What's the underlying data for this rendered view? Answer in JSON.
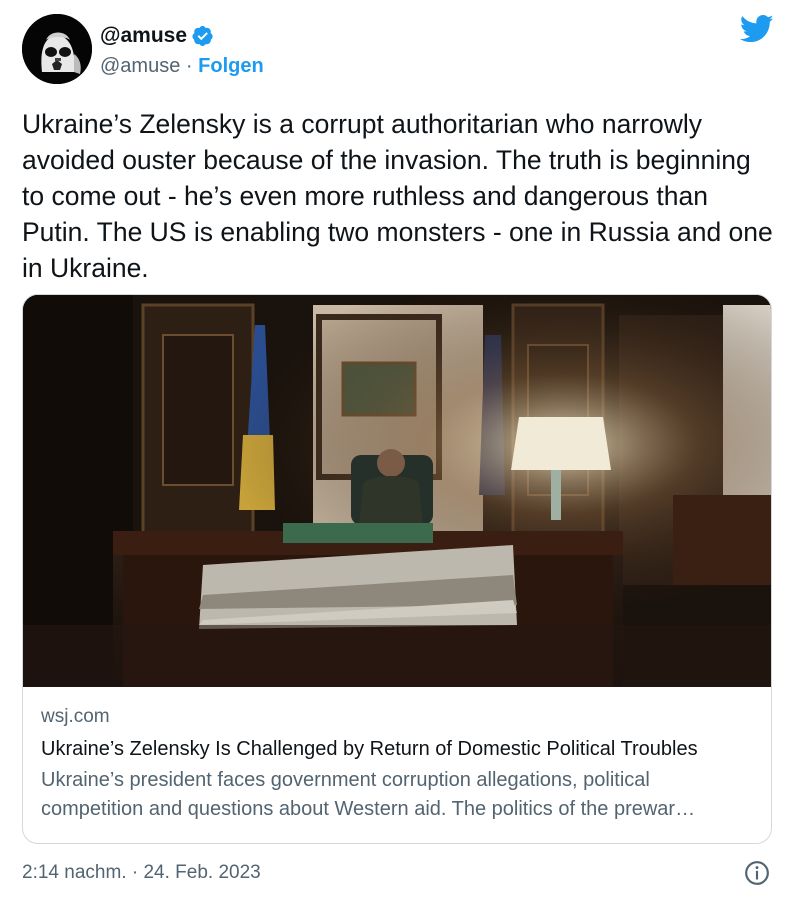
{
  "author": {
    "display_name": "@amuse",
    "handle": "@amuse",
    "separator": "·",
    "follow_label": "Folgen",
    "verified": true
  },
  "tweet": {
    "text": "Ukraine’s Zelensky is a corrupt authoritarian who narrowly avoided ouster because of the invasion. The truth is beginning to come out - he’s even more ruthless and dangerous than Putin. The US is enabling two monsters - one in Russia and one in Ukraine."
  },
  "card": {
    "domain": "wsj.com",
    "title": "Ukraine’s Zelensky Is Challenged by Return of Domestic Political Troubles",
    "description": "Ukraine’s president faces government corruption allegations, political competition and questions about Western aid. The politics of the prewar…"
  },
  "footer": {
    "timestamp": "2:14 nachm. · 24. Feb. 2023"
  },
  "colors": {
    "accent": "#1d9bf0",
    "text_primary": "#0f1419",
    "text_secondary": "#536471",
    "border": "#cfd9de"
  },
  "icons": {
    "brand": "twitter-bird-icon",
    "verified": "verified-badge-icon",
    "info": "info-icon"
  }
}
